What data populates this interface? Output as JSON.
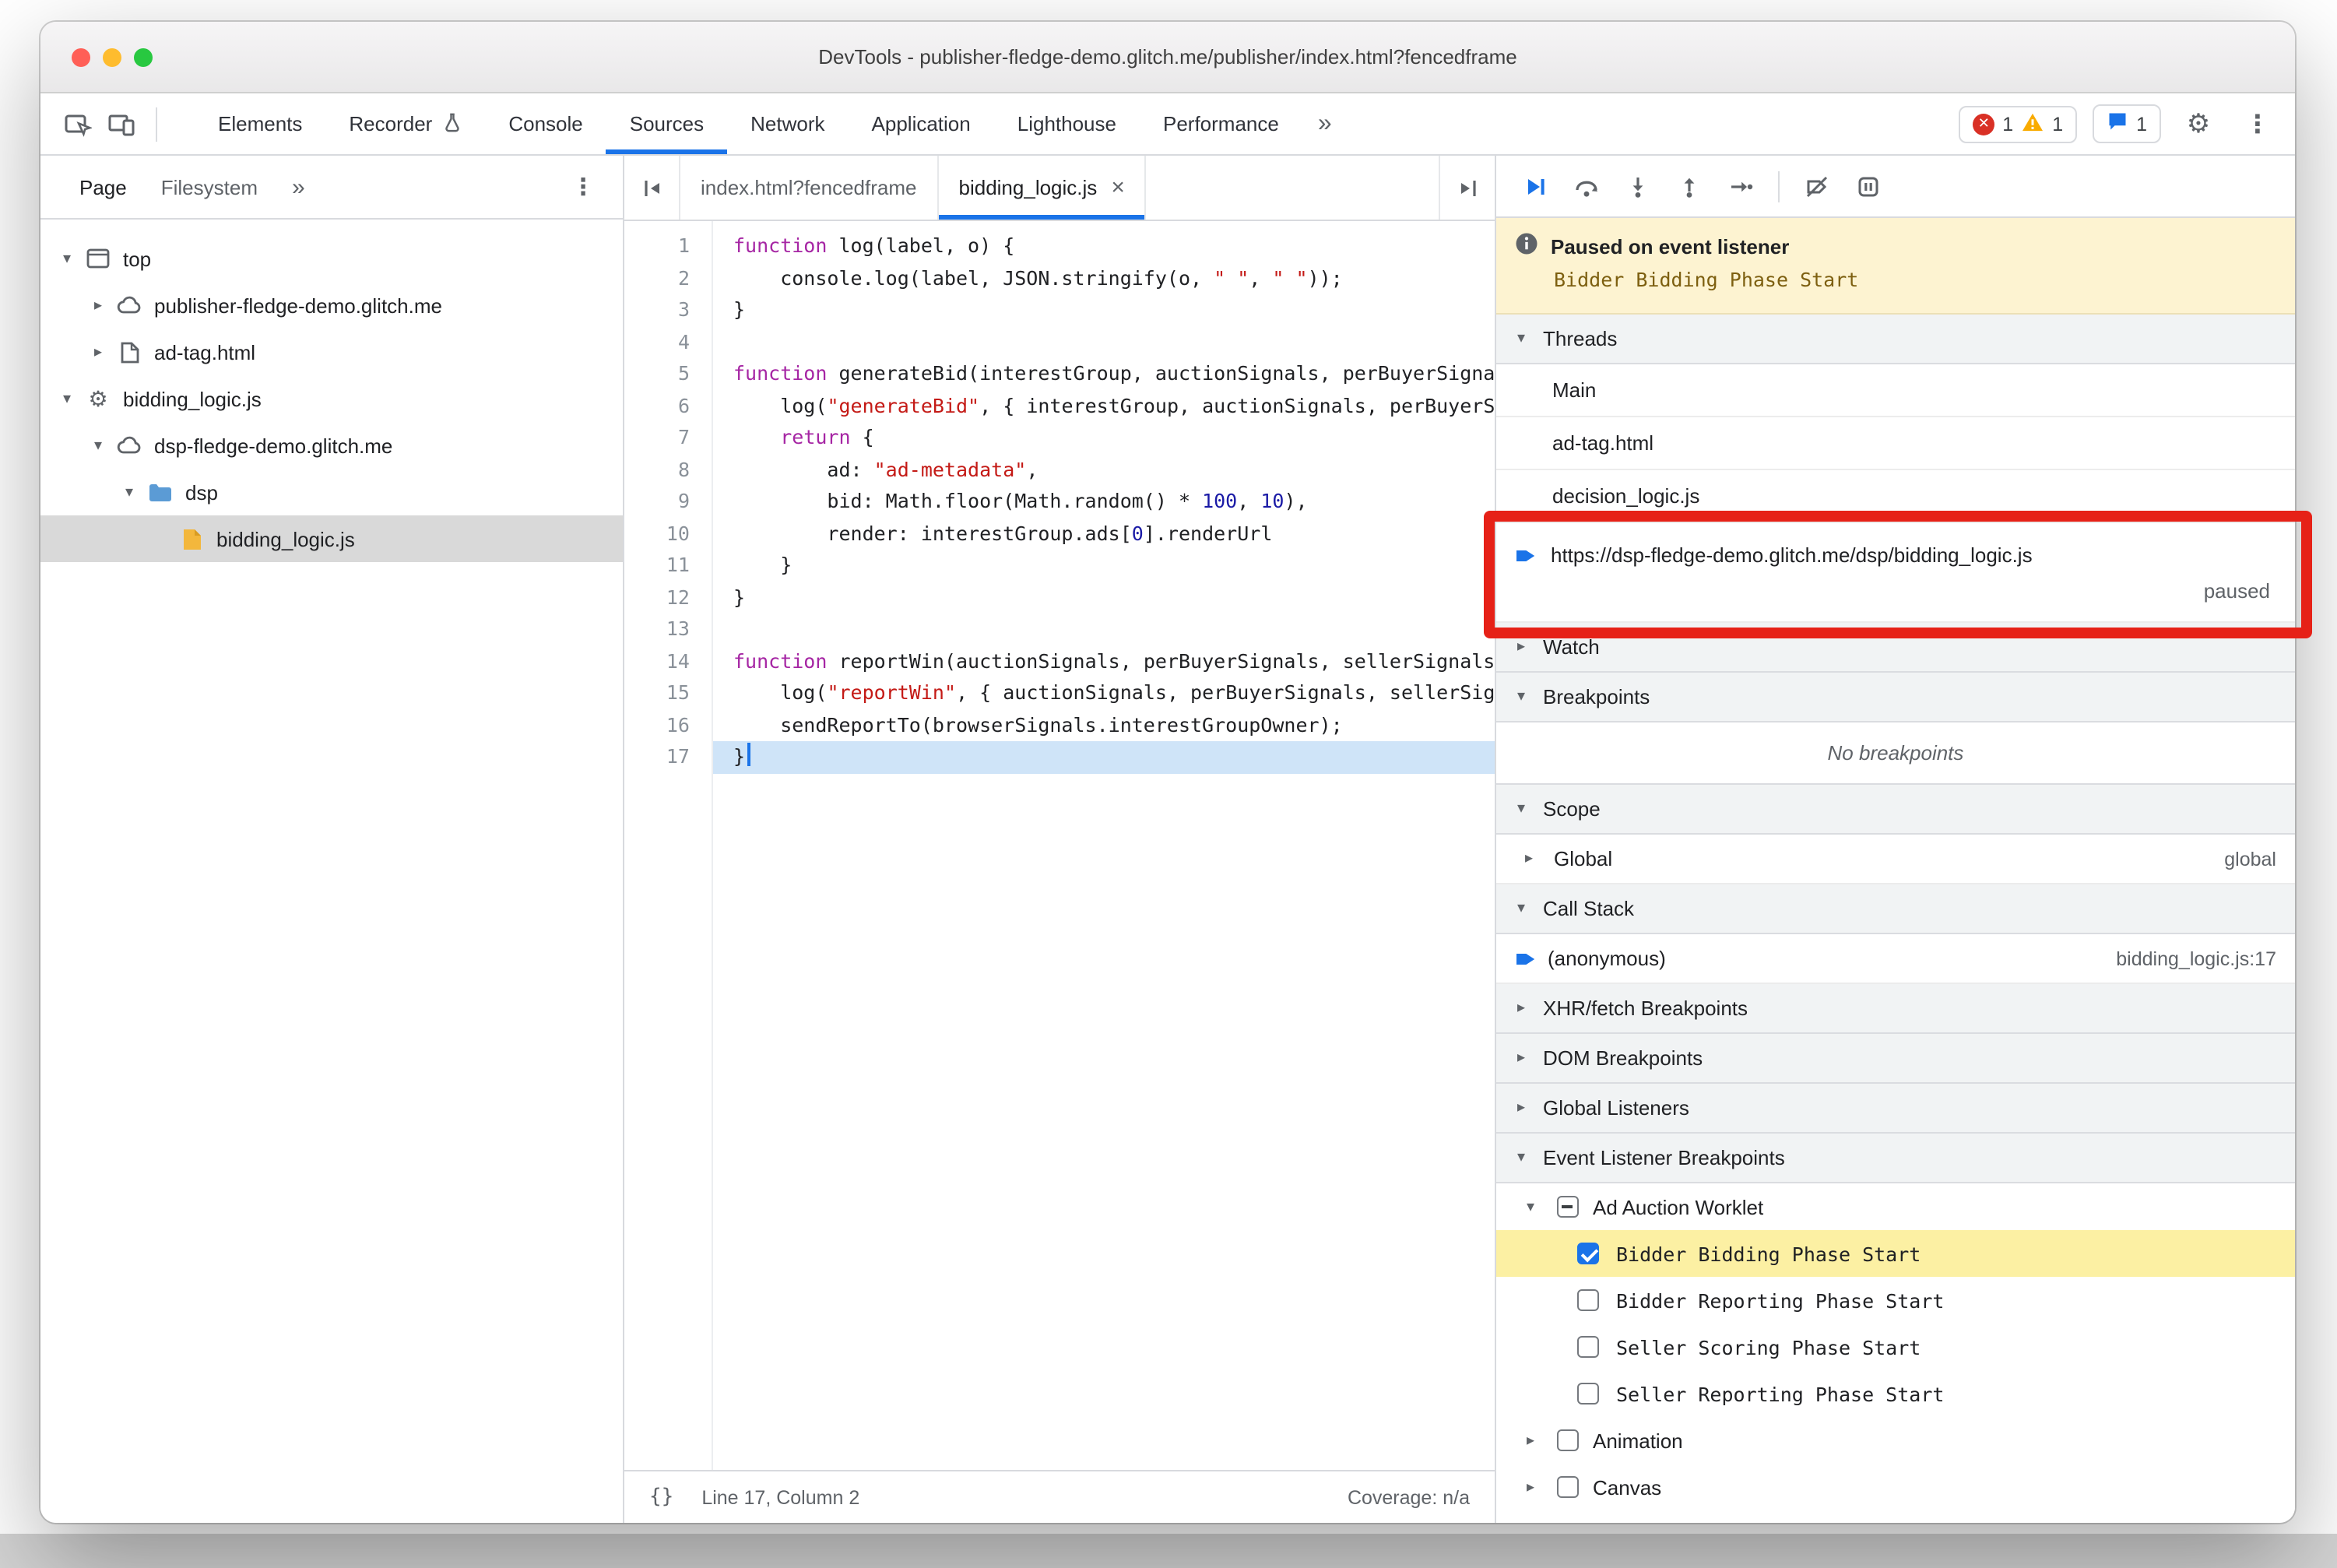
{
  "window": {
    "title": "DevTools - publisher-fledge-demo.glitch.me/publisher/index.html?fencedframe"
  },
  "colors": {
    "accent": "#1a73e8",
    "annotation": "#e62117",
    "paused_banner_bg": "#fdf3d1",
    "highlight_row": "#fcf0a3",
    "selected_row": "#d9d9d9",
    "error": "#d93025",
    "warning": "#f9ab00"
  },
  "toolbar": {
    "tabs": [
      {
        "label": "Elements"
      },
      {
        "label": "Recorder",
        "badge_icon": "flask-icon"
      },
      {
        "label": "Console"
      },
      {
        "label": "Sources",
        "active": true
      },
      {
        "label": "Network"
      },
      {
        "label": "Application"
      },
      {
        "label": "Lighthouse"
      },
      {
        "label": "Performance"
      }
    ],
    "more_label": "»",
    "badges": {
      "errors": "1",
      "warnings": "1",
      "messages": "1"
    }
  },
  "sidebar": {
    "tabs": [
      {
        "label": "Page",
        "active": true
      },
      {
        "label": "Filesystem"
      }
    ],
    "more_label": "»",
    "tree": [
      {
        "label": "top",
        "icon": "frame",
        "twisty": "open",
        "depth": 0
      },
      {
        "label": "publisher-fledge-demo.glitch.me",
        "icon": "cloud",
        "twisty": "closed",
        "depth": 1
      },
      {
        "label": "ad-tag.html",
        "icon": "document",
        "twisty": "closed",
        "depth": 1
      },
      {
        "label": "bidding_logic.js",
        "icon": "gear",
        "twisty": "open",
        "depth": 0
      },
      {
        "label": "dsp-fledge-demo.glitch.me",
        "icon": "cloud",
        "twisty": "open",
        "depth": 1
      },
      {
        "label": "dsp",
        "icon": "folder",
        "twisty": "open",
        "depth": 2
      },
      {
        "label": "bidding_logic.js",
        "icon": "file-js",
        "twisty": "none",
        "depth": 3,
        "selected": true
      }
    ]
  },
  "editor": {
    "tabs": [
      {
        "label": "index.html?fencedframe"
      },
      {
        "label": "bidding_logic.js",
        "active": true,
        "closable": true
      }
    ],
    "code": {
      "paused_line": 17,
      "lines": [
        [
          [
            "k",
            "function"
          ],
          [
            "d",
            " log(label, o) {"
          ]
        ],
        [
          [
            "d",
            "    console.log(label, JSON.stringify(o, "
          ],
          [
            "s",
            "\" \""
          ],
          [
            "d",
            ", "
          ],
          [
            "s",
            "\" \""
          ],
          [
            "d",
            "));"
          ]
        ],
        [
          [
            "d",
            "}"
          ]
        ],
        [],
        [
          [
            "k",
            "function"
          ],
          [
            "d",
            " generateBid(interestGroup, auctionSignals, perBuyerSignals, trustedBiddingSignals, browserSignals) {"
          ]
        ],
        [
          [
            "d",
            "    log("
          ],
          [
            "s",
            "\"generateBid\""
          ],
          [
            "d",
            ", { interestGroup, auctionSignals, perBuyerSignals, trustedBiddingSignals, browserSignals });"
          ]
        ],
        [
          [
            "d",
            "    "
          ],
          [
            "k",
            "return"
          ],
          [
            "d",
            " {"
          ]
        ],
        [
          [
            "d",
            "        ad: "
          ],
          [
            "s",
            "\"ad-metadata\""
          ],
          [
            "d",
            ","
          ]
        ],
        [
          [
            "d",
            "        bid: Math.floor(Math.random() * "
          ],
          [
            "n",
            "100"
          ],
          [
            "d",
            ", "
          ],
          [
            "n",
            "10"
          ],
          [
            "d",
            "),"
          ]
        ],
        [
          [
            "d",
            "        render: interestGroup.ads["
          ],
          [
            "n",
            "0"
          ],
          [
            "d",
            "].renderUrl"
          ]
        ],
        [
          [
            "d",
            "    }"
          ]
        ],
        [
          [
            "d",
            "}"
          ]
        ],
        [],
        [
          [
            "k",
            "function"
          ],
          [
            "d",
            " reportWin(auctionSignals, perBuyerSignals, sellerSignals, browserSignals) {"
          ]
        ],
        [
          [
            "d",
            "    log("
          ],
          [
            "s",
            "\"reportWin\""
          ],
          [
            "d",
            ", { auctionSignals, perBuyerSignals, sellerSignals, browserSignals });"
          ]
        ],
        [
          [
            "d",
            "    sendReportTo(browserSignals.interestGroupOwner);"
          ]
        ],
        [
          [
            "d",
            "}"
          ]
        ]
      ]
    },
    "status": {
      "format_label": "{}",
      "line_col": "Line 17, Column 2",
      "coverage": "Coverage: n/a"
    }
  },
  "debugger": {
    "toolbar_icons": [
      "resume",
      "step-over",
      "step-into",
      "step-out",
      "step",
      "deactivate-breakpoints",
      "pause-on-exceptions"
    ],
    "paused_banner": {
      "title": "Paused on event listener",
      "detail": "Bidder Bidding Phase Start"
    },
    "threads": {
      "title": "Threads",
      "items": [
        {
          "label": "Main"
        },
        {
          "label": "ad-tag.html"
        },
        {
          "label": "decision_logic.js"
        },
        {
          "label": "https://dsp-fledge-demo.glitch.me/dsp/bidding_logic.js",
          "active": true,
          "status": "paused"
        }
      ]
    },
    "watch": {
      "title": "Watch"
    },
    "breakpoints": {
      "title": "Breakpoints",
      "empty_label": "No breakpoints"
    },
    "scope": {
      "title": "Scope",
      "rows": [
        {
          "label": "Global",
          "right": "global"
        }
      ]
    },
    "call_stack": {
      "title": "Call Stack",
      "rows": [
        {
          "label": "(anonymous)",
          "right": "bidding_logic.js:17",
          "active": true
        }
      ]
    },
    "xhr_breakpoints": {
      "title": "XHR/fetch Breakpoints"
    },
    "dom_breakpoints": {
      "title": "DOM Breakpoints"
    },
    "global_listeners": {
      "title": "Global Listeners"
    },
    "event_listener_breakpoints": {
      "title": "Event Listener Breakpoints",
      "groups": [
        {
          "label": "Ad Auction Worklet",
          "checkbox": "indeterminate",
          "expanded": true,
          "children": [
            {
              "label": "Bidder Bidding Phase Start",
              "checked": true,
              "highlighted": true
            },
            {
              "label": "Bidder Reporting Phase Start",
              "checked": false
            },
            {
              "label": "Seller Scoring Phase Start",
              "checked": false
            },
            {
              "label": "Seller Reporting Phase Start",
              "checked": false
            }
          ]
        },
        {
          "label": "Animation",
          "checkbox": "unchecked",
          "expanded": false
        },
        {
          "label": "Canvas",
          "checkbox": "unchecked",
          "expanded": false
        }
      ]
    }
  }
}
